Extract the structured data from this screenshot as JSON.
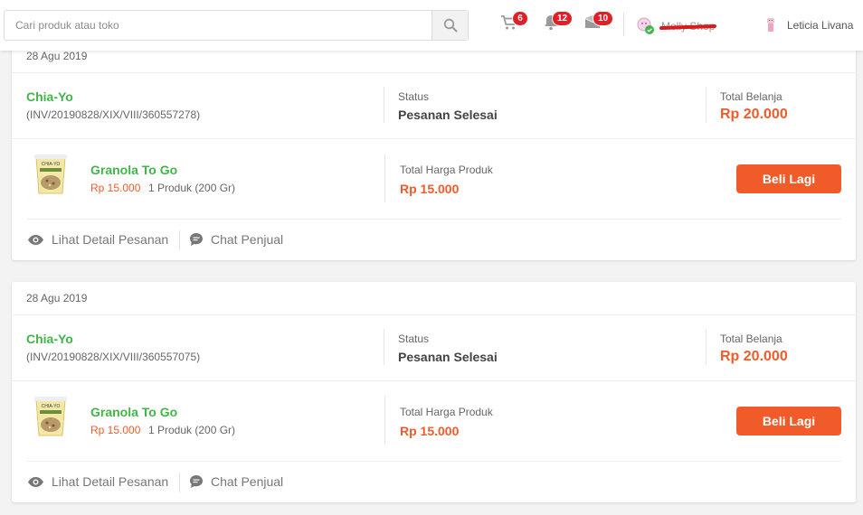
{
  "header": {
    "search_placeholder": "Cari produk atau toko",
    "cart_count": "6",
    "notif_count": "12",
    "inbox_count": "10",
    "shop_name": "Molly Shop",
    "user_name": "Leticia Livana"
  },
  "colors": {
    "green": "#42b549",
    "orange": "#f15b2a",
    "badge": "#e21f26"
  },
  "orders": [
    {
      "date": "28 Agu 2019",
      "shop": "Chia-Yo",
      "invoice": "(INV/20190828/XIX/VIII/360557278)",
      "status_label": "Status",
      "status": "Pesanan Selesai",
      "total_label": "Total Belanja",
      "total": "Rp 20.000",
      "product_name": "Granola To Go",
      "product_price": "Rp 15.000",
      "product_qty": "1 Produk (200 Gr)",
      "product_total_label": "Total Harga Produk",
      "product_total": "Rp 15.000",
      "buy_again": "Beli Lagi",
      "detail_link": "Lihat Detail Pesanan",
      "chat_link": "Chat Penjual"
    },
    {
      "date": "28 Agu 2019",
      "shop": "Chia-Yo",
      "invoice": "(INV/20190828/XIX/VIII/360557075)",
      "status_label": "Status",
      "status": "Pesanan Selesai",
      "total_label": "Total Belanja",
      "total": "Rp 20.000",
      "product_name": "Granola To Go",
      "product_price": "Rp 15.000",
      "product_qty": "1 Produk (200 Gr)",
      "product_total_label": "Total Harga Produk",
      "product_total": "Rp 15.000",
      "buy_again": "Beli Lagi",
      "detail_link": "Lihat Detail Pesanan",
      "chat_link": "Chat Penjual"
    }
  ]
}
